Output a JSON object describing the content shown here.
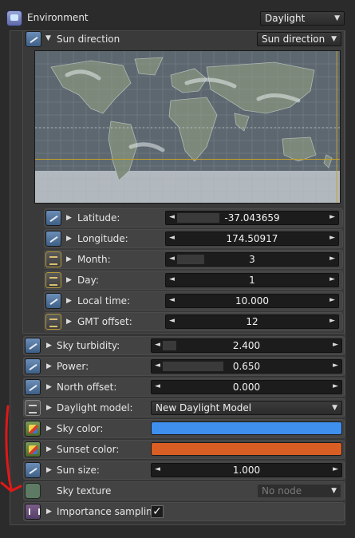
{
  "environment": {
    "label": "Environment",
    "dropdown_value": "Daylight"
  },
  "sun_direction": {
    "label": "Sun direction",
    "dropdown_value": "Sun direction",
    "params": [
      {
        "label": "Latitude:",
        "value": "-37.043659",
        "fill": 0.28,
        "icon": "float"
      },
      {
        "label": "Longitude:",
        "value": "174.50917",
        "fill": 0.0,
        "icon": "float"
      },
      {
        "label": "Month:",
        "value": "3",
        "fill": 0.18,
        "icon": "int"
      },
      {
        "label": "Day:",
        "value": "1",
        "fill": 0.0,
        "icon": "int"
      },
      {
        "label": "Local time:",
        "value": "10.000",
        "fill": 0.0,
        "icon": "float"
      },
      {
        "label": "GMT offset:",
        "value": "12",
        "fill": 0.0,
        "icon": "int"
      }
    ]
  },
  "params": [
    {
      "label": "Sky turbidity:",
      "type": "slider",
      "value": "2.400",
      "fill": 0.08,
      "icon": "float"
    },
    {
      "label": "Power:",
      "type": "slider",
      "value": "0.650",
      "fill": 0.36,
      "icon": "float"
    },
    {
      "label": "North offset:",
      "type": "slider",
      "value": "0.000",
      "fill": 0.0,
      "icon": "float"
    },
    {
      "label": "Daylight model:",
      "type": "dropdown",
      "value": "New Daylight Model",
      "icon": "enum"
    },
    {
      "label": "Sky color:",
      "type": "color",
      "color": "#3f8fef",
      "icon": "color"
    },
    {
      "label": "Sunset color:",
      "type": "color",
      "color": "#d95e24",
      "icon": "color"
    },
    {
      "label": "Sun size:",
      "type": "slider",
      "value": "1.000",
      "fill": 0.0,
      "icon": "float"
    },
    {
      "label": "Sky texture",
      "type": "node",
      "value": "No node",
      "icon": "texture"
    },
    {
      "label": "Importance sampling:",
      "type": "checkbox",
      "checked": true,
      "check_glyph": "✓",
      "icon": "bool"
    }
  ],
  "colors": {
    "sky": "#3f8fef",
    "sunset": "#d95e24",
    "crosshair": "#c9a227",
    "annotation_arrow": "#e01818"
  }
}
